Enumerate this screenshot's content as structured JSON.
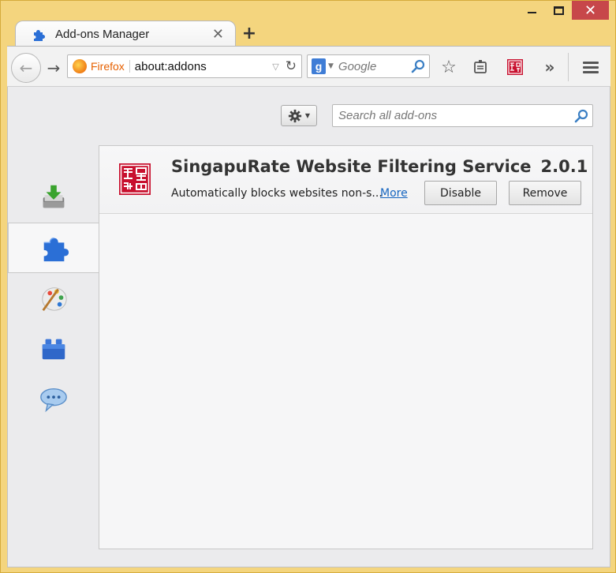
{
  "window": {
    "minimize_icon": "minimize-icon",
    "maximize_icon": "maximize-icon",
    "close_icon": "close-icon",
    "frame_color": "#f4d57e"
  },
  "tab": {
    "title": "Add-ons Manager",
    "close": "✕",
    "new_tab": "+"
  },
  "toolbar": {
    "identity_label": "Firefox",
    "url": "about:addons",
    "search_engine": "Google",
    "search_logo": "g",
    "overflow": "»"
  },
  "addons_header": {
    "search_placeholder": "Search all add-ons"
  },
  "categories": [
    {
      "name": "get-add-ons",
      "icon": "download-icon"
    },
    {
      "name": "extensions",
      "icon": "puzzle-icon",
      "selected": true
    },
    {
      "name": "appearance",
      "icon": "palette-icon"
    },
    {
      "name": "plugins",
      "icon": "lego-brick-icon"
    },
    {
      "name": "services",
      "icon": "speech-bubble-icon"
    }
  ],
  "addon": {
    "name": "SingapuRate Website Filtering Service",
    "version": "2.0.1",
    "description": "Automatically blocks websites non-s...",
    "more_label": "More",
    "disable_label": "Disable",
    "remove_label": "Remove",
    "accent": "#c8102e"
  }
}
